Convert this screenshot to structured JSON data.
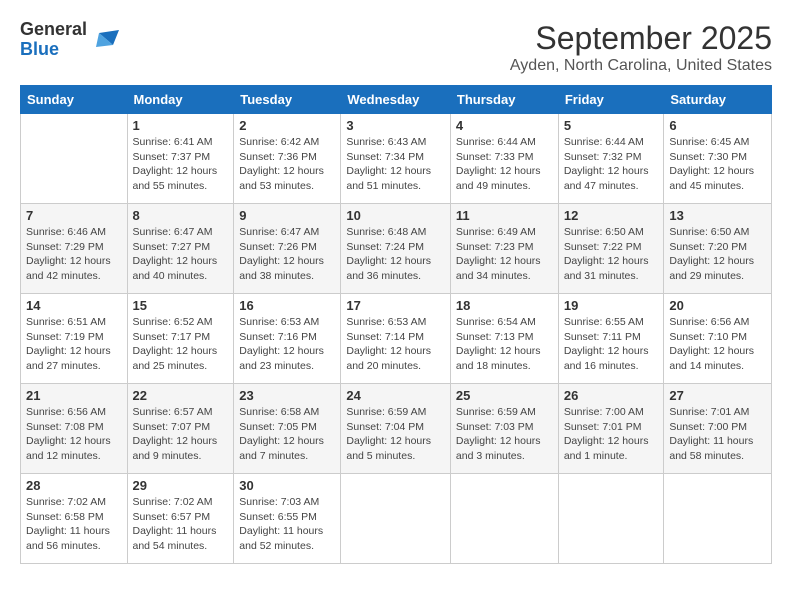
{
  "header": {
    "logo_general": "General",
    "logo_blue": "Blue",
    "month_year": "September 2025",
    "location": "Ayden, North Carolina, United States"
  },
  "days_of_week": [
    "Sunday",
    "Monday",
    "Tuesday",
    "Wednesday",
    "Thursday",
    "Friday",
    "Saturday"
  ],
  "weeks": [
    [
      {
        "day": "",
        "info": ""
      },
      {
        "day": "1",
        "info": "Sunrise: 6:41 AM\nSunset: 7:37 PM\nDaylight: 12 hours\nand 55 minutes."
      },
      {
        "day": "2",
        "info": "Sunrise: 6:42 AM\nSunset: 7:36 PM\nDaylight: 12 hours\nand 53 minutes."
      },
      {
        "day": "3",
        "info": "Sunrise: 6:43 AM\nSunset: 7:34 PM\nDaylight: 12 hours\nand 51 minutes."
      },
      {
        "day": "4",
        "info": "Sunrise: 6:44 AM\nSunset: 7:33 PM\nDaylight: 12 hours\nand 49 minutes."
      },
      {
        "day": "5",
        "info": "Sunrise: 6:44 AM\nSunset: 7:32 PM\nDaylight: 12 hours\nand 47 minutes."
      },
      {
        "day": "6",
        "info": "Sunrise: 6:45 AM\nSunset: 7:30 PM\nDaylight: 12 hours\nand 45 minutes."
      }
    ],
    [
      {
        "day": "7",
        "info": "Sunrise: 6:46 AM\nSunset: 7:29 PM\nDaylight: 12 hours\nand 42 minutes."
      },
      {
        "day": "8",
        "info": "Sunrise: 6:47 AM\nSunset: 7:27 PM\nDaylight: 12 hours\nand 40 minutes."
      },
      {
        "day": "9",
        "info": "Sunrise: 6:47 AM\nSunset: 7:26 PM\nDaylight: 12 hours\nand 38 minutes."
      },
      {
        "day": "10",
        "info": "Sunrise: 6:48 AM\nSunset: 7:24 PM\nDaylight: 12 hours\nand 36 minutes."
      },
      {
        "day": "11",
        "info": "Sunrise: 6:49 AM\nSunset: 7:23 PM\nDaylight: 12 hours\nand 34 minutes."
      },
      {
        "day": "12",
        "info": "Sunrise: 6:50 AM\nSunset: 7:22 PM\nDaylight: 12 hours\nand 31 minutes."
      },
      {
        "day": "13",
        "info": "Sunrise: 6:50 AM\nSunset: 7:20 PM\nDaylight: 12 hours\nand 29 minutes."
      }
    ],
    [
      {
        "day": "14",
        "info": "Sunrise: 6:51 AM\nSunset: 7:19 PM\nDaylight: 12 hours\nand 27 minutes."
      },
      {
        "day": "15",
        "info": "Sunrise: 6:52 AM\nSunset: 7:17 PM\nDaylight: 12 hours\nand 25 minutes."
      },
      {
        "day": "16",
        "info": "Sunrise: 6:53 AM\nSunset: 7:16 PM\nDaylight: 12 hours\nand 23 minutes."
      },
      {
        "day": "17",
        "info": "Sunrise: 6:53 AM\nSunset: 7:14 PM\nDaylight: 12 hours\nand 20 minutes."
      },
      {
        "day": "18",
        "info": "Sunrise: 6:54 AM\nSunset: 7:13 PM\nDaylight: 12 hours\nand 18 minutes."
      },
      {
        "day": "19",
        "info": "Sunrise: 6:55 AM\nSunset: 7:11 PM\nDaylight: 12 hours\nand 16 minutes."
      },
      {
        "day": "20",
        "info": "Sunrise: 6:56 AM\nSunset: 7:10 PM\nDaylight: 12 hours\nand 14 minutes."
      }
    ],
    [
      {
        "day": "21",
        "info": "Sunrise: 6:56 AM\nSunset: 7:08 PM\nDaylight: 12 hours\nand 12 minutes."
      },
      {
        "day": "22",
        "info": "Sunrise: 6:57 AM\nSunset: 7:07 PM\nDaylight: 12 hours\nand 9 minutes."
      },
      {
        "day": "23",
        "info": "Sunrise: 6:58 AM\nSunset: 7:05 PM\nDaylight: 12 hours\nand 7 minutes."
      },
      {
        "day": "24",
        "info": "Sunrise: 6:59 AM\nSunset: 7:04 PM\nDaylight: 12 hours\nand 5 minutes."
      },
      {
        "day": "25",
        "info": "Sunrise: 6:59 AM\nSunset: 7:03 PM\nDaylight: 12 hours\nand 3 minutes."
      },
      {
        "day": "26",
        "info": "Sunrise: 7:00 AM\nSunset: 7:01 PM\nDaylight: 12 hours\nand 1 minute."
      },
      {
        "day": "27",
        "info": "Sunrise: 7:01 AM\nSunset: 7:00 PM\nDaylight: 11 hours\nand 58 minutes."
      }
    ],
    [
      {
        "day": "28",
        "info": "Sunrise: 7:02 AM\nSunset: 6:58 PM\nDaylight: 11 hours\nand 56 minutes."
      },
      {
        "day": "29",
        "info": "Sunrise: 7:02 AM\nSunset: 6:57 PM\nDaylight: 11 hours\nand 54 minutes."
      },
      {
        "day": "30",
        "info": "Sunrise: 7:03 AM\nSunset: 6:55 PM\nDaylight: 11 hours\nand 52 minutes."
      },
      {
        "day": "",
        "info": ""
      },
      {
        "day": "",
        "info": ""
      },
      {
        "day": "",
        "info": ""
      },
      {
        "day": "",
        "info": ""
      }
    ]
  ]
}
